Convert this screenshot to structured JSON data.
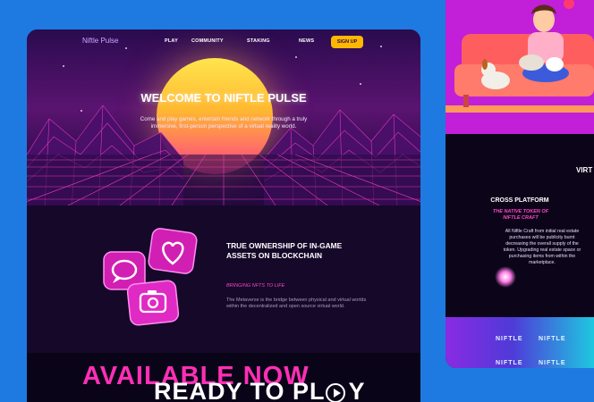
{
  "main": {
    "nav": {
      "logo": "Niftle Pulse",
      "links": [
        "PLAY",
        "COMMUNITY",
        "STAKING",
        "NEWS"
      ],
      "signup": "SIGN UP"
    },
    "hero": {
      "title": "WELCOME TO NIFTLE PULSE",
      "text": "Come and play games, entertain friends and network through a truly immersive, first-person perspective of a virtual reality world."
    },
    "feature": {
      "title": "TRUE OWNERSHIP OF IN-GAME ASSETS ON BLOCKCHAIN",
      "subtitle": "BRINGING NFTS TO LIFE",
      "text": "The Metaverse is the bridge between physical and virtual worlds within the decentralized and open source virtual world."
    },
    "banner": {
      "available": "AVAILABLE NOW",
      "ready": "READY TO PL",
      "ready_tail": "Y"
    }
  },
  "side": {
    "virt": "VIRT",
    "cross_title": "CROSS PLATFORM",
    "token": "THE NATIVE TOKEN OF NIFTLE CRAFT",
    "text": "All Niftle Craft from initial real estate purchases will be publicity burnt decreasing the overall supply of the token. Upgrading real estate space or purchasing items from within the marketplace.",
    "logos": [
      "NIFTLE",
      "NIFTLE",
      "NIFTLE",
      "NIFTLE"
    ]
  },
  "colors": {
    "background": "#1E7AE0",
    "accent_pink": "#FF2FB5",
    "signup_yellow": "#FFB800"
  }
}
